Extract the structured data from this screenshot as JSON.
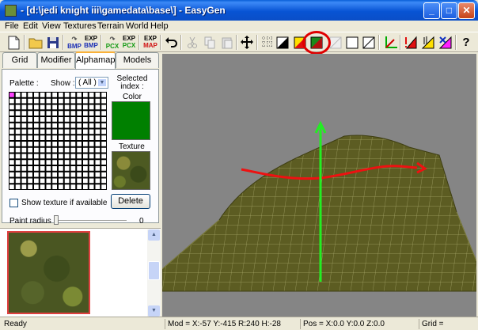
{
  "window": {
    "title": "- [d:\\jedi knight iii\\gamedata\\base\\] - EasyGen",
    "minimize": "_",
    "maximize": "□",
    "close": "✕"
  },
  "menu": [
    "File",
    "Edit",
    "View",
    "Textures",
    "Terrain",
    "World",
    "Help"
  ],
  "toolbar": {
    "bmp_label": "BMP",
    "exp_label": "EXP",
    "pcx_label": "PCX",
    "map_label": "MAP",
    "help_label": "?"
  },
  "tabs": [
    "Grid",
    "Modifier",
    "Alphamap",
    "Models"
  ],
  "alphamap": {
    "palette_label": "Palette :",
    "show_label": "Show :",
    "show_value": "( All )",
    "selected_index_label": "Selected index :",
    "color_label": "Color",
    "texture_label": "Texture",
    "show_texture_label": "Show texture if available",
    "delete_label": "Delete",
    "paint_radius_label": "Paint radius :",
    "paint_radius_value": "0",
    "paint_radius_level": 0,
    "selected_color": "#008000"
  },
  "status": {
    "ready": "Ready",
    "mod": "Mod = X:-57 Y:-415 R:240 H:-28",
    "pos": "Pos = X:0.0 Y:0.0 Z:0.0",
    "grid": "Grid ="
  },
  "colors": {
    "terrain": "#5a5a22",
    "axis_green": "#22ee22",
    "axis_red": "#ee1111",
    "highlight": "#e00000"
  }
}
